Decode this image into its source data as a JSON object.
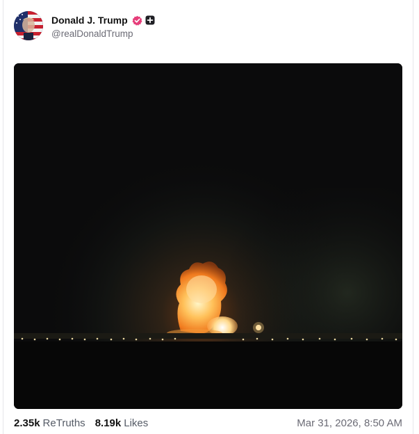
{
  "post": {
    "author": {
      "display_name": "Donald J. Trump",
      "handle": "@realDonaldTrump",
      "avatar_icon": "flag-portrait-avatar",
      "verified_icon": "verified-badge-icon",
      "verified_color": "#e63e7a",
      "extra_icon": "plus-square-icon"
    },
    "media": {
      "type": "video-still",
      "background_color": "#0b0b0c"
    },
    "stats": {
      "retruths_count": "2.35k",
      "retruths_label": "ReTruths",
      "likes_count": "8.19k",
      "likes_label": "Likes"
    },
    "timestamp": "Mar 31, 2026, 8:50 AM"
  }
}
